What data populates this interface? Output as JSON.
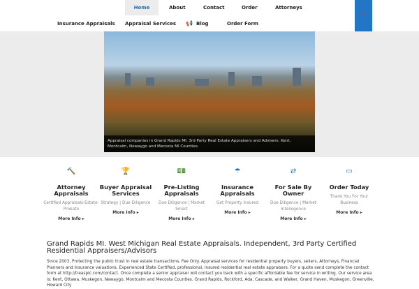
{
  "nav": {
    "row1": [
      "Home",
      "About",
      "Contact",
      "Order",
      "Attorneys"
    ],
    "row2": [
      "Insurance Appraisals",
      "Appraisal Services",
      "Blog",
      "Order Form"
    ]
  },
  "hero": {
    "caption": "Appraisal companies in Grand Rapids MI. 3rd Party Real Estate Appraisers and Advisers. Kent, Montcalm, Newaygo and Mecosta MI Counties."
  },
  "features": [
    {
      "icon": "gavel-icon",
      "glyph": "🔨",
      "title": "Attorney Appraisals",
      "desc": "Certified Appraisals-Estate-Probate",
      "more": "More Info ▸"
    },
    {
      "icon": "trophy-icon",
      "glyph": "🏆",
      "title": "Buyer Appraisal Services",
      "desc": "Strategy | Due Diligence",
      "more": "More Info ▸"
    },
    {
      "icon": "money-icon",
      "glyph": "💵",
      "title": "Pre-Listing Appraisals",
      "desc": "Due Diligence | Market Smart",
      "more": "More Info ▸"
    },
    {
      "icon": "umbrella-icon",
      "glyph": "☂",
      "title": "Insurance Appraisals",
      "desc": "Get Property Insured",
      "more": "More Info ▸"
    },
    {
      "icon": "exchange-icon",
      "glyph": "⇄",
      "title": "For Sale By Owner",
      "desc": "Due Diligence | Market Intellegence",
      "more": "More Info ▸"
    },
    {
      "icon": "credit-card-icon",
      "glyph": "▭",
      "title": "Order Today",
      "desc": "Thank You For Your Business",
      "more": "More Info ▸"
    }
  ],
  "main": {
    "heading": "Grand Rapids MI. West Michigan Real Estate Appraisals. Independent, 3rd Party Certified Residential Appraisers/Advisors",
    "body": "Since 2003, Protecting the public trust in real estate transactions. Fee Only. Appraisal services for residential property buyers, sellers, Attorneys, Financial Planners and Insurance valuations. Experienced State Certified, professional, insured residential real estate appraisers. For a quote send complete the contact form at http://treasplc.com/contact. Once complete a senior appraiser will contact you back with a specific affordable fee for service in writing. Our service area is: Kent, Ottawa, Muskegon, Newaygo, Montcalm and Mecosta Counties. Grand Rapids, Rockford, Ada, Cascade, and Walker, Grand Haven, Muskegon, Greenville, Howard City"
  }
}
